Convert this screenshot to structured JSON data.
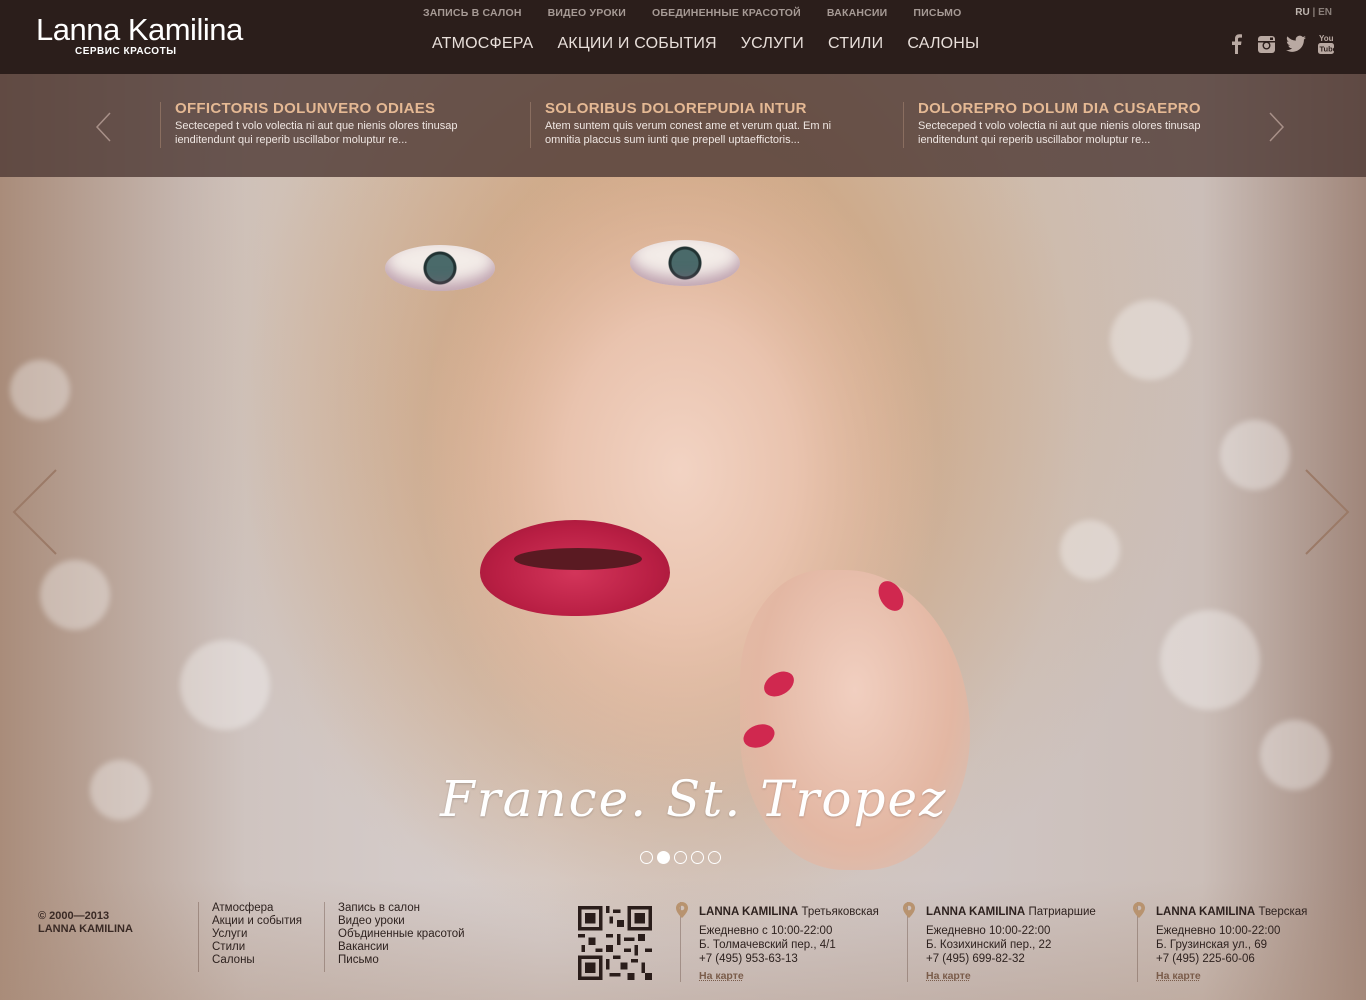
{
  "header": {
    "logo": "Lanna Kamilina",
    "logo_sub": "СЕРВИС КРАСОТЫ",
    "top_nav": [
      "ЗАПИСЬ В САЛОН",
      "ВИДЕО УРОКИ",
      "ОБЕДИНЕННЫЕ КРАСОТОЙ",
      "ВАКАНСИИ",
      "ПИСЬМО"
    ],
    "main_nav": [
      "АТМОСФЕРА",
      "АКЦИИ И СОБЫТИЯ",
      "УСЛУГИ",
      "СТИЛИ",
      "САЛОНЫ"
    ],
    "lang": {
      "ru": "RU",
      "sep": "|",
      "en": "EN"
    },
    "socials": [
      "facebook-icon",
      "instagram-icon",
      "twitter-icon",
      "youtube-icon"
    ]
  },
  "news": [
    {
      "title": "OFFICTORIS DOLUNVERO ODIAES",
      "text": "Secteceped t volo volectia ni aut que nienis olores tinusap ienditendunt qui reperib uscillabor moluptur re..."
    },
    {
      "title": "SOLORIBUS DOLOREPUDIA INTUR",
      "text": "Atem suntem quis verum conest ame et verum quat. Em ni omnitia placcus sum iunti que prepell uptaeffictoris..."
    },
    {
      "title": "DOLOREPRO DOLUM DIA CUSAEPRO",
      "text": "Secteceped t volo volectia ni aut que nienis olores tinusap ienditendunt qui reperib uscillabor moluptur re..."
    }
  ],
  "hero": {
    "caption": "France. St. Tropez",
    "slides_count": 5,
    "active_slide": 2
  },
  "footer": {
    "copyright_years": "© 2000—2013",
    "copyright_name": "LANNA KAMILINA",
    "col1": [
      "Атмосфера",
      "Акции и события",
      "Услуги",
      "Стили",
      "Салоны"
    ],
    "col2": [
      "Запись в салон",
      "Видео уроки",
      "Объдиненные красотой",
      "Вакансии",
      "Письмо"
    ],
    "salons": [
      {
        "brand": "LANNA KAMILINA",
        "name": "Третьяковская",
        "hours": "Ежедневно с 10:00-22:00",
        "address": "Б. Толмачевский пер., 4/1",
        "phone": "+7 (495) 953-63-13",
        "map": "На карте"
      },
      {
        "brand": "LANNA KAMILINA",
        "name": "Патриаршие",
        "hours": "Ежедневно 10:00-22:00",
        "address": "Б. Козихинский пер., 22",
        "phone": "+7 (495) 699-82-32",
        "map": "На карте"
      },
      {
        "brand": "LANNA KAMILINA",
        "name": "Тверская",
        "hours": "Ежедневно 10:00-22:00",
        "address": "Б. Грузинская ул., 69",
        "phone": "+7 (495) 225-60-06",
        "map": "На карте"
      }
    ]
  },
  "colors": {
    "header_bg": "#2b1e1b",
    "news_title": "#e5b994",
    "accent": "#9b7a67"
  }
}
